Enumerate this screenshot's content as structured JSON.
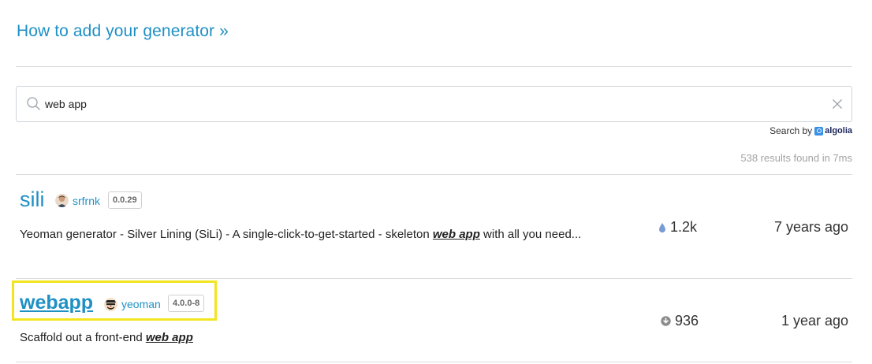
{
  "header": {
    "add_generator_link": "How to add your generator »"
  },
  "search": {
    "value": "web app",
    "searchby_label": "Search by",
    "algolia_label": "algolia",
    "results_summary": "538 results found in 7ms"
  },
  "results": [
    {
      "name": "sili",
      "author": "srfrnk",
      "version": "0.0.29",
      "description_before": "Yeoman generator - Silver Lining (SiLi) - A single-click-to-get-started - skeleton ",
      "description_highlight": "web app",
      "description_after": " with all you need...",
      "stat_icon": "drop-icon",
      "stat_value": "1.2k",
      "updated": "7 years ago"
    },
    {
      "name": "webapp",
      "author": "yeoman",
      "version": "4.0.0-8",
      "description_before": "Scaffold out a front-end ",
      "description_highlight": "web app",
      "description_after": "",
      "stat_icon": "download-icon",
      "stat_value": "936",
      "updated": "1 year ago"
    }
  ],
  "colors": {
    "link": "#1f90c4",
    "highlight_outline": "#f1e51f",
    "muted": "#a3a3a3"
  }
}
